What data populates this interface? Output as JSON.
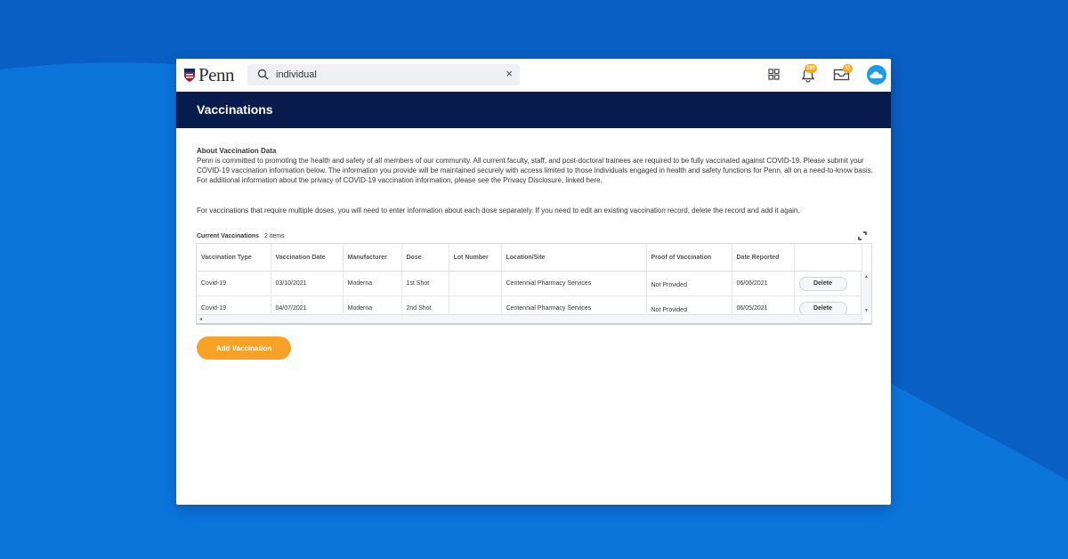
{
  "app": {
    "logo_text": "Penn",
    "search": {
      "value": "individual",
      "placeholder": "Search"
    },
    "clear_glyph": "×",
    "badges": {
      "notifications": "190",
      "inbox": "11"
    },
    "icons": [
      "apps-grid-icon",
      "bell-icon",
      "inbox-icon",
      "cloud-avatar-icon"
    ]
  },
  "page": {
    "title": "Vaccinations",
    "about_title": "About Vaccination Data",
    "about_text": "Penn is committed to promoting the health and safety of all members of our community. All current faculty, staff, and post-doctoral trainees are required to be fully vaccinated against COVID-19.  Please submit your COVID-19 vaccination information below.  The information you provide will be maintained securely with access limited to those individuals engaged in health and safety functions for Penn, all on a need-to-know basis.  For additional information about the privacy of COVID-19 vaccination information, please see the Privacy Disclosure, linked here.",
    "multi_dose_text": "For vaccinations that require multiple doses, you will need to enter information about each dose separately. If you need to edit an existing vaccination record, delete the record and add it again."
  },
  "vaccinations": {
    "label": "Current Vaccinations",
    "count": "2 items",
    "columns": [
      "Vaccination Type",
      "Vaccination Date",
      "Manufacturer",
      "Dose",
      "Lot Number",
      "Location/Site",
      "Proof of Vaccination",
      "Date Reported",
      ""
    ],
    "rows": [
      [
        "Covid-19",
        "03/10/2021",
        "Moderna",
        "1st Shot",
        "",
        "Centennial Pharmacy Services",
        "Not Provided",
        "06/06/2021"
      ],
      [
        "Covid-19",
        "04/07/2021",
        "Moderna",
        "2nd Shot",
        "",
        "Centennial Pharmacy Services",
        "Not Provided",
        "06/05/2021"
      ]
    ],
    "delete_label": "Delete",
    "add_label": "Add Vaccination"
  },
  "colors": {
    "background": "#0a63c9",
    "title_band": "#071b4c",
    "accent_orange": "#f7a127",
    "badge": "#f5a623",
    "avatar": "#1e9be8"
  }
}
